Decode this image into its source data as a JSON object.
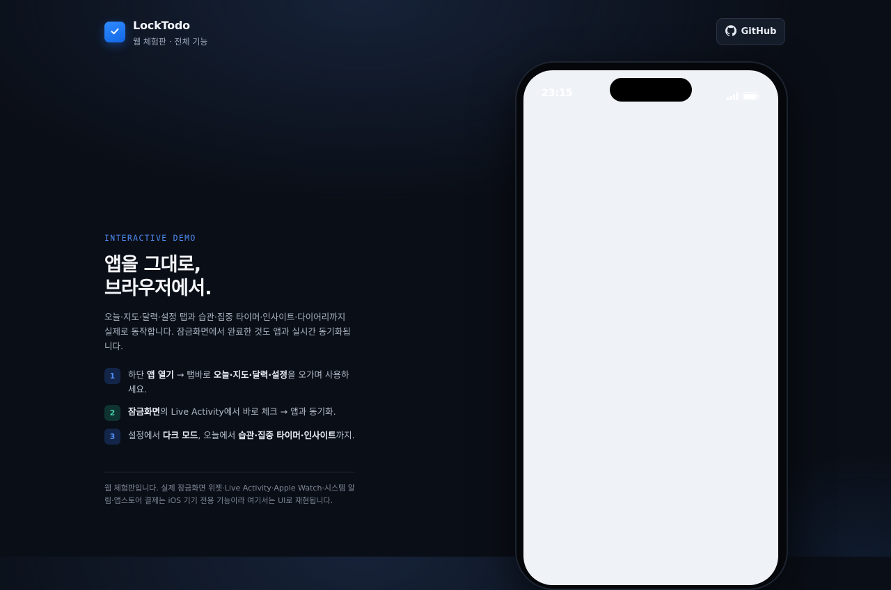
{
  "header": {
    "brand_title": "LockTodo",
    "brand_subtitle": "웹 체험판 · 전체 기능",
    "github_label": "GitHub",
    "logo_icon": "check-icon",
    "github_icon": "github-icon"
  },
  "hero": {
    "eyebrow": "INTERACTIVE DEMO",
    "headline_line1": "앱을 그대로,",
    "headline_line2": "브라우저에서.",
    "description": "오늘·지도·달력·설정 탭과 습관·집중 타이머·인사이트·다이어리까지 실제로 동작합니다. 잠금화면에서 완료한 것도 앱과 실시간 동기화됩니다."
  },
  "steps": [
    {
      "num": "1",
      "color": "#4e8df5",
      "bg": "#13264a",
      "parts": [
        "하단 ",
        "앱 열기",
        " → 탭바로 ",
        "오늘·지도·달력·설정",
        "을 오가며 사용하세요."
      ]
    },
    {
      "num": "2",
      "color": "#3fd1a8",
      "bg": "#0f3330",
      "parts": [
        "잠금화면",
        "의 Live Activity에서 바로 체크 → 앱과 동기화."
      ]
    },
    {
      "num": "3",
      "color": "#4e8df5",
      "bg": "#13264a",
      "parts": [
        "설정에서 ",
        "다크 모드",
        ", 오늘에서 ",
        "습관·집중 타이머·인사이트",
        "까지."
      ]
    }
  ],
  "footnote": "웹 체험판입니다. 실제 잠금화면 위젯·Live Activity·Apple Watch·시스템 알림·앱스토어 결제는 iOS 기기 전용 기능이라 여기서는 UI로 재현됩니다.",
  "phone": {
    "status_time": "23:15",
    "signal_icon": "signal-icon",
    "battery_icon": "battery-icon",
    "screen_bg": "#eff3f8"
  }
}
